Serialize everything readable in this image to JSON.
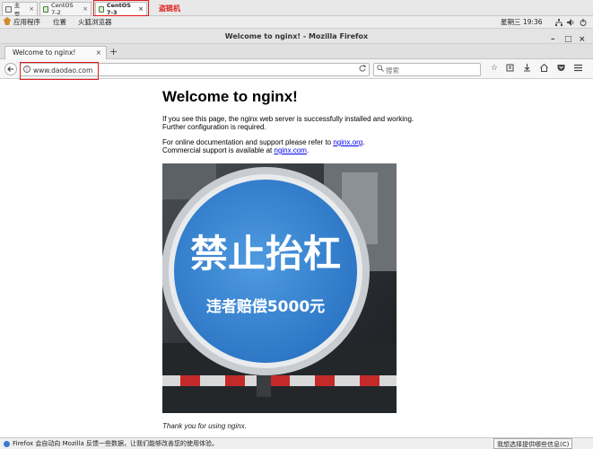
{
  "vm_tabs": [
    {
      "label": "主页",
      "close": "×"
    },
    {
      "label": "CentOS 7-2",
      "close": "×"
    },
    {
      "label": "CentOS 7-3",
      "close": "×"
    }
  ],
  "annotation_label": "盗链机",
  "gnome_menu": [
    "应用程序",
    "位置",
    "火狐浏览器"
  ],
  "clock": "星期三 19:36",
  "window_title": "Welcome to nginx! - Mozilla Firefox",
  "window_controls": {
    "minimize": "–",
    "maximize": "□",
    "close": "×"
  },
  "browser_tab": {
    "title": "Welcome to nginx!",
    "close": "×",
    "new_tab": "+"
  },
  "address_bar": {
    "url": "www.daodao.com"
  },
  "search_bar": {
    "placeholder": "搜索"
  },
  "page": {
    "heading": "Welcome to nginx!",
    "para1_line1": "If you see this page, the nginx web server is successfully installed and working.",
    "para1_line2": "Further configuration is required.",
    "para2_prefix": "For online documentation and support please refer to ",
    "link1": "nginx.org",
    "para2_suffix": ".",
    "para3_prefix": "Commercial support is available at ",
    "link2": "nginx.com",
    "para3_suffix": ".",
    "sign_text_main": "禁止抬杠",
    "sign_text_sub": "违者赔偿5000元",
    "thanks": "Thank you for using nginx."
  },
  "notification": {
    "message": "Firefox 会自动向 Mozilla 反馈一些数据，让我们能够改善您的使用体验。",
    "button": "我想选择提供哪些信息(C)"
  },
  "colors": {
    "annotation_red": "#e21b1b",
    "sign_blue": "#2f7fd0",
    "link": "#0000ee"
  }
}
